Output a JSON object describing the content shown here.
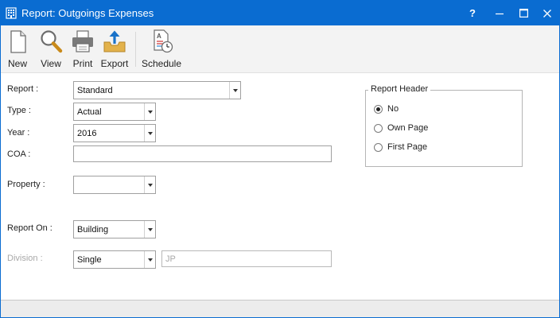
{
  "window": {
    "title": "Report: Outgoings Expenses",
    "help_label": "?",
    "title_color": "#0a6cd1"
  },
  "toolbar": {
    "items": [
      {
        "label": "New",
        "icon": "new-document-icon"
      },
      {
        "label": "View",
        "icon": "magnifier-icon"
      },
      {
        "label": "Print",
        "icon": "printer-icon"
      },
      {
        "label": "Export",
        "icon": "export-tray-icon"
      },
      {
        "label": "Schedule",
        "icon": "schedule-report-icon"
      }
    ]
  },
  "form": {
    "report": {
      "label": "Report :",
      "value": "Standard"
    },
    "type": {
      "label": "Type :",
      "value": "Actual"
    },
    "year": {
      "label": "Year :",
      "value": "2016"
    },
    "coa": {
      "label": "COA :",
      "value": ""
    },
    "property": {
      "label": "Property :",
      "value": ""
    },
    "report_on": {
      "label": "Report On :",
      "value": "Building"
    },
    "division": {
      "label": "Division :",
      "value": "Single",
      "code": "JP"
    }
  },
  "report_header": {
    "title": "Report Header",
    "options": [
      {
        "label": "No",
        "checked": true
      },
      {
        "label": "Own Page",
        "checked": false
      },
      {
        "label": "First Page",
        "checked": false
      }
    ]
  }
}
